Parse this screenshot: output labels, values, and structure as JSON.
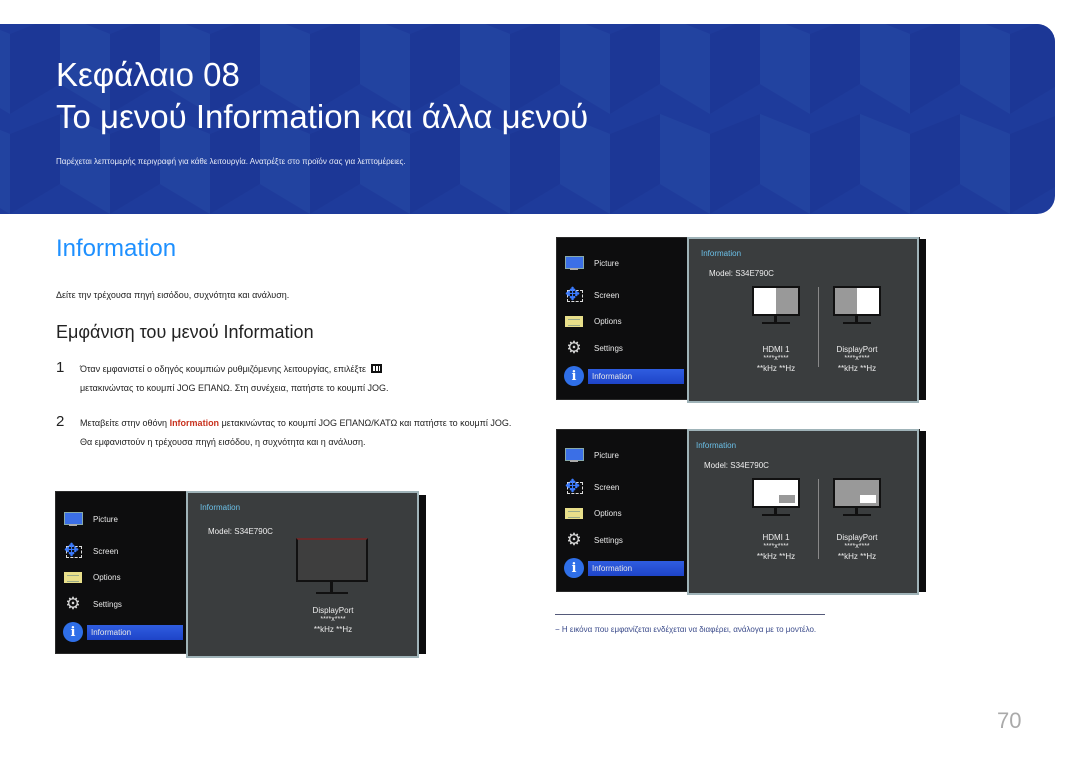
{
  "banner": {
    "chapter": "Κεφάλαιο 08",
    "title": "Το μενού Information και άλλα μενού",
    "subtitle": "Παρέχεται λεπτομερής περιγραφή για κάθε λειτουργία. Ανατρέξτε στο προϊόν σας για λεπτομέρειες.",
    "color": "#1e3b9b"
  },
  "section": {
    "title": "Information",
    "description": "Δείτε την τρέχουσα πηγή εισόδου, συχνότητα και ανάλυση.",
    "subtitle": "Εμφάνιση του μενού Information"
  },
  "steps": [
    {
      "num": "1",
      "text_before": "Όταν εμφανιστεί ο οδηγός κουμπιών ρυθμιζόμενης λειτουργίας, επιλέξτε",
      "icon": "menu-icon",
      "text_after": "μετακινώντας το κουμπί JOG ΕΠΑΝΩ. Στη συνέχεια, πατήστε το κουμπί JOG."
    },
    {
      "num": "2",
      "text_before": "Μεταβείτε στην οθόνη",
      "highlight": "Information",
      "text_after": "μετακινώντας το κουμπί JOG ΕΠΑΝΩ/ΚΑΤΩ και πατήστε το κουμπί JOG. Θα εμφανιστούν η τρέχουσα πηγή εισόδου, η συχνότητα και η ανάλυση."
    }
  ],
  "osd_menu": {
    "items": [
      {
        "label": "Picture",
        "icon": "picture-icon"
      },
      {
        "label": "Screen",
        "icon": "screen-icon"
      },
      {
        "label": "Options",
        "icon": "options-icon"
      },
      {
        "label": "Settings",
        "icon": "settings-icon"
      },
      {
        "label": "Information",
        "icon": "info-icon",
        "active": true
      }
    ],
    "panel_title": "Information",
    "model": "Model: S34E790C"
  },
  "screens": {
    "single": {
      "sources": [
        {
          "name": "DisplayPort",
          "resolution": "****x****",
          "frequency": "**kHz **Hz"
        }
      ]
    },
    "pbp": {
      "sources": [
        {
          "name": "HDMI 1",
          "resolution": "****x****",
          "frequency": "**kHz **Hz"
        },
        {
          "name": "DisplayPort",
          "resolution": "****x****",
          "frequency": "**kHz **Hz"
        }
      ]
    },
    "pip": {
      "sources": [
        {
          "name": "HDMI 1",
          "resolution": "****x****",
          "frequency": "**kHz **Hz"
        },
        {
          "name": "DisplayPort",
          "resolution": "****x****",
          "frequency": "**kHz **Hz"
        }
      ]
    }
  },
  "footnote": "−  Η εικόνα που εμφανίζεται ενδέχεται να διαφέρει, ανάλογα με το μοντέλο.",
  "page_number": "70"
}
